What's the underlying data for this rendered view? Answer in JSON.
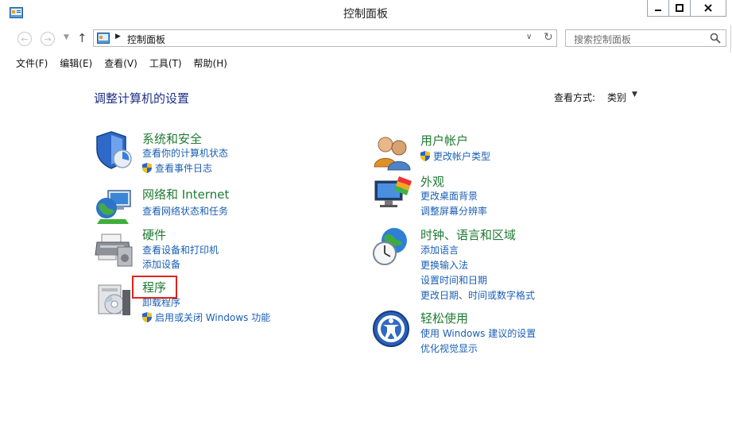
{
  "window": {
    "title": "控制面板"
  },
  "address": {
    "path": "控制面板",
    "search_placeholder": "搜索控制面板"
  },
  "menu": [
    "文件(F)",
    "编辑(E)",
    "查看(V)",
    "工具(T)",
    "帮助(H)"
  ],
  "page": {
    "title": "调整计算机的设置",
    "view_by_label": "查看方式:",
    "view_by_value": "类别"
  },
  "categories_left": [
    {
      "title": "系统和安全",
      "links": [
        "查看你的计算机状态",
        "查看事件日志"
      ]
    },
    {
      "title": "网络和 Internet",
      "links": [
        "查看网络状态和任务"
      ]
    },
    {
      "title": "硬件",
      "links": [
        "查看设备和打印机",
        "添加设备"
      ]
    },
    {
      "title": "程序",
      "links": [
        "卸载程序",
        "启用或关闭 Windows 功能"
      ]
    }
  ],
  "categories_right": [
    {
      "title": "用户帐户",
      "links": [
        "更改帐户类型"
      ]
    },
    {
      "title": "外观",
      "links": [
        "更改桌面背景",
        "调整屏幕分辨率"
      ]
    },
    {
      "title": "时钟、语言和区域",
      "links": [
        "添加语言",
        "更换输入法",
        "设置时间和日期",
        "更改日期、时间或数字格式"
      ]
    },
    {
      "title": "轻松使用",
      "links": [
        "使用 Windows 建议的设置",
        "优化视觉显示"
      ]
    }
  ],
  "colors": {
    "title_blue": "#1e3287",
    "category_green": "#1f7a33",
    "link_blue": "#1a5fb4",
    "highlight_red": "#e2231a"
  },
  "icons": [
    "control-panel-icon",
    "back-icon",
    "forward-icon",
    "up-icon",
    "refresh-icon",
    "search-icon",
    "shield-icon"
  ]
}
